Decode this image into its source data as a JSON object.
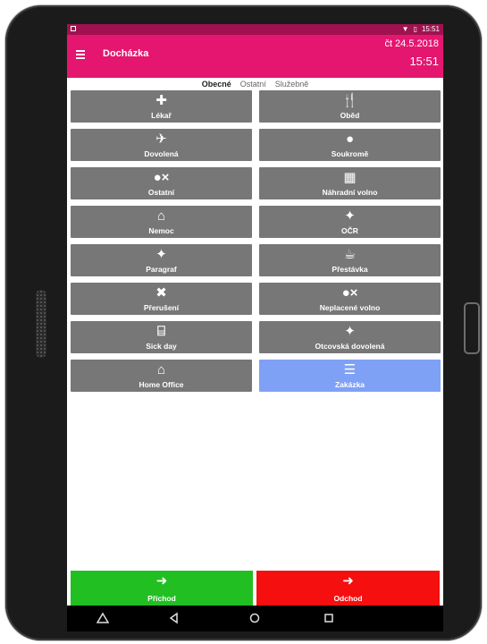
{
  "status": {
    "time": "15:51"
  },
  "app": {
    "title": "Docházka",
    "date": "čt 24.5.2018",
    "time": "15:51"
  },
  "tabs": [
    {
      "label": "Obecné",
      "active": true
    },
    {
      "label": "Ostatní",
      "active": false
    },
    {
      "label": "Služebně",
      "active": false
    }
  ],
  "tiles": [
    {
      "label": "Lékař",
      "icon": "plus-icon",
      "glyph": "✚"
    },
    {
      "label": "Oběd",
      "icon": "fork-knife-icon",
      "glyph": "🍴"
    },
    {
      "label": "Dovolená",
      "icon": "airplane-icon",
      "glyph": "✈"
    },
    {
      "label": "Soukromě",
      "icon": "user-icon",
      "glyph": "●"
    },
    {
      "label": "Ostatní",
      "icon": "user-remove-icon",
      "glyph": "●×"
    },
    {
      "label": "Náhradní volno",
      "icon": "calendar-x-icon",
      "glyph": "▦"
    },
    {
      "label": "Nemoc",
      "icon": "sick-bed-icon",
      "glyph": "⌂"
    },
    {
      "label": "OČR",
      "icon": "child-icon",
      "glyph": "✦"
    },
    {
      "label": "Paragraf",
      "icon": "child-icon",
      "glyph": "✦"
    },
    {
      "label": "Přestávka",
      "icon": "coffee-icon",
      "glyph": "☕"
    },
    {
      "label": "Přerušení",
      "icon": "close-icon",
      "glyph": "✖"
    },
    {
      "label": "Neplacené volno",
      "icon": "user-remove-icon",
      "glyph": "●×"
    },
    {
      "label": "Sick day",
      "icon": "bed-icon",
      "glyph": "⌸"
    },
    {
      "label": "Otcovská dovolená",
      "icon": "child-icon",
      "glyph": "✦"
    },
    {
      "label": "Home Office",
      "icon": "home-icon",
      "glyph": "⌂"
    },
    {
      "label": "Zakázka",
      "icon": "list-check-icon",
      "glyph": "☰"
    }
  ],
  "actions": {
    "arrival": {
      "label": "Příchod",
      "glyph": "➜",
      "icon": "sign-in-icon",
      "color": "#22bf22"
    },
    "departure": {
      "label": "Odchod",
      "glyph": "➜",
      "icon": "sign-out-icon",
      "color": "#f50f0f"
    }
  },
  "colors": {
    "accent": "#e5166f",
    "tile": "#777777",
    "tile_selected": "#7fa1f5"
  }
}
